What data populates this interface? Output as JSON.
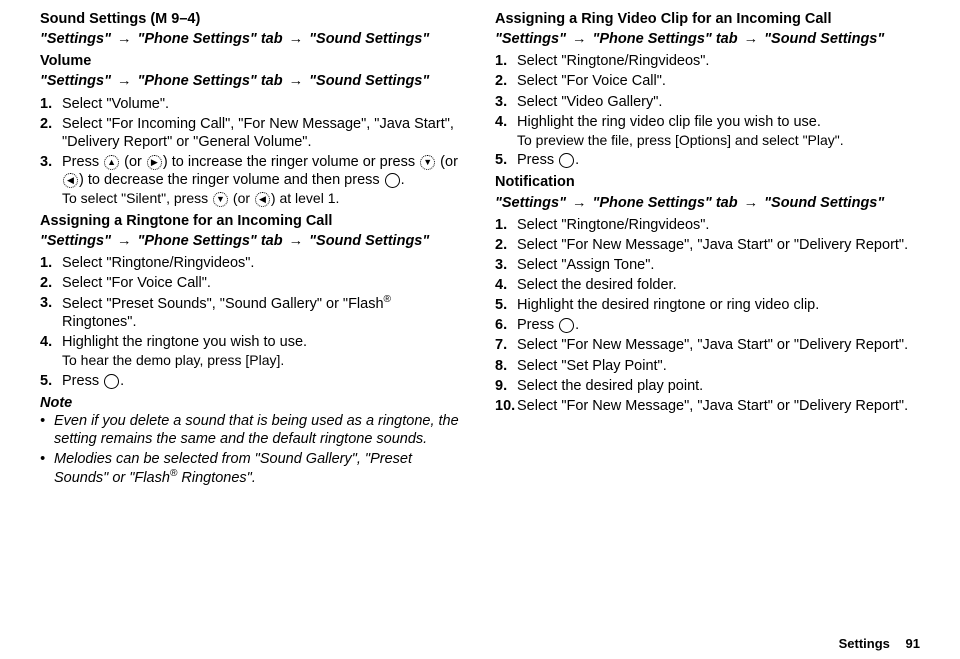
{
  "left": {
    "sound_title": "Sound Settings (M 9–4)",
    "sound_path_a": "\"Settings\"",
    "sound_path_b": "\"Phone Settings\" tab",
    "sound_path_c": "\"Sound Settings\"",
    "volume_head": "Volume",
    "volume_steps": [
      {
        "num": "1.",
        "text": "Select \"Volume\"."
      },
      {
        "num": "2.",
        "text": "Select \"For Incoming Call\", \"For New Message\", \"Java Start\", \"Delivery Report\" or \"General Volume\"."
      },
      {
        "num": "3.",
        "pre": "Press ",
        "mid1": " (or ",
        "mid2": ") to increase the ringer volume or press ",
        "mid3": " (or ",
        "mid4": ") to decrease the ringer volume and then press ",
        "end": ".",
        "sub_pre": "To select \"Silent\", press ",
        "sub_mid": " (or ",
        "sub_end": ") at level 1."
      }
    ],
    "ringtone_head": "Assigning a Ringtone for an Incoming Call",
    "ringtone_steps": [
      {
        "num": "1.",
        "text": "Select \"Ringtone/Ringvideos\"."
      },
      {
        "num": "2.",
        "text": "Select \"For Voice Call\"."
      },
      {
        "num": "3.",
        "pre": "Select \"Preset Sounds\", \"Sound Gallery\" or \"Flash",
        "sup": "®",
        "post": " Ringtones\"."
      },
      {
        "num": "4.",
        "text": "Highlight the ringtone you wish to use.",
        "sub": "To hear the demo play, press [Play]."
      },
      {
        "num": "5.",
        "pre": "Press ",
        "icon": true,
        "post": "."
      }
    ],
    "note_title": "Note",
    "notes": [
      "Even if you delete a sound that is being used as a ringtone, the setting remains the same and the default ringtone sounds.",
      {
        "pre": "Melodies can be selected from \"Sound Gallery\", \"Preset Sounds\" or \"Flash",
        "sup": "®",
        "post": " Ringtones\"."
      }
    ]
  },
  "right": {
    "ringvideo_head": "Assigning a Ring Video Clip for an Incoming Call",
    "ringvideo_steps": [
      {
        "num": "1.",
        "text": "Select \"Ringtone/Ringvideos\"."
      },
      {
        "num": "2.",
        "text": "Select \"For Voice Call\"."
      },
      {
        "num": "3.",
        "text": "Select \"Video Gallery\"."
      },
      {
        "num": "4.",
        "text": "Highlight the ring video clip file you wish to use.",
        "sub": "To preview the file, press [Options] and select \"Play\"."
      },
      {
        "num": "5.",
        "pre": "Press ",
        "icon": true,
        "post": "."
      }
    ],
    "notif_head": "Notification",
    "notif_steps": [
      {
        "num": "1.",
        "text": "Select \"Ringtone/Ringvideos\"."
      },
      {
        "num": "2.",
        "text": "Select \"For New Message\", \"Java Start\" or \"Delivery Report\"."
      },
      {
        "num": "3.",
        "text": "Select \"Assign Tone\"."
      },
      {
        "num": "4.",
        "text": "Select the desired folder."
      },
      {
        "num": "5.",
        "text": "Highlight the desired ringtone or ring video clip."
      },
      {
        "num": "6.",
        "pre": "Press ",
        "icon": true,
        "post": "."
      },
      {
        "num": "7.",
        "text": "Select \"For New Message\", \"Java Start\" or \"Delivery Report\"."
      },
      {
        "num": "8.",
        "text": "Select \"Set Play Point\"."
      },
      {
        "num": "9.",
        "text": "Select the desired play point."
      },
      {
        "num": "10.",
        "text": "Select \"For New Message\", \"Java Start\" or \"Delivery Report\"."
      }
    ]
  },
  "footer": {
    "label": "Settings",
    "page": "91"
  }
}
